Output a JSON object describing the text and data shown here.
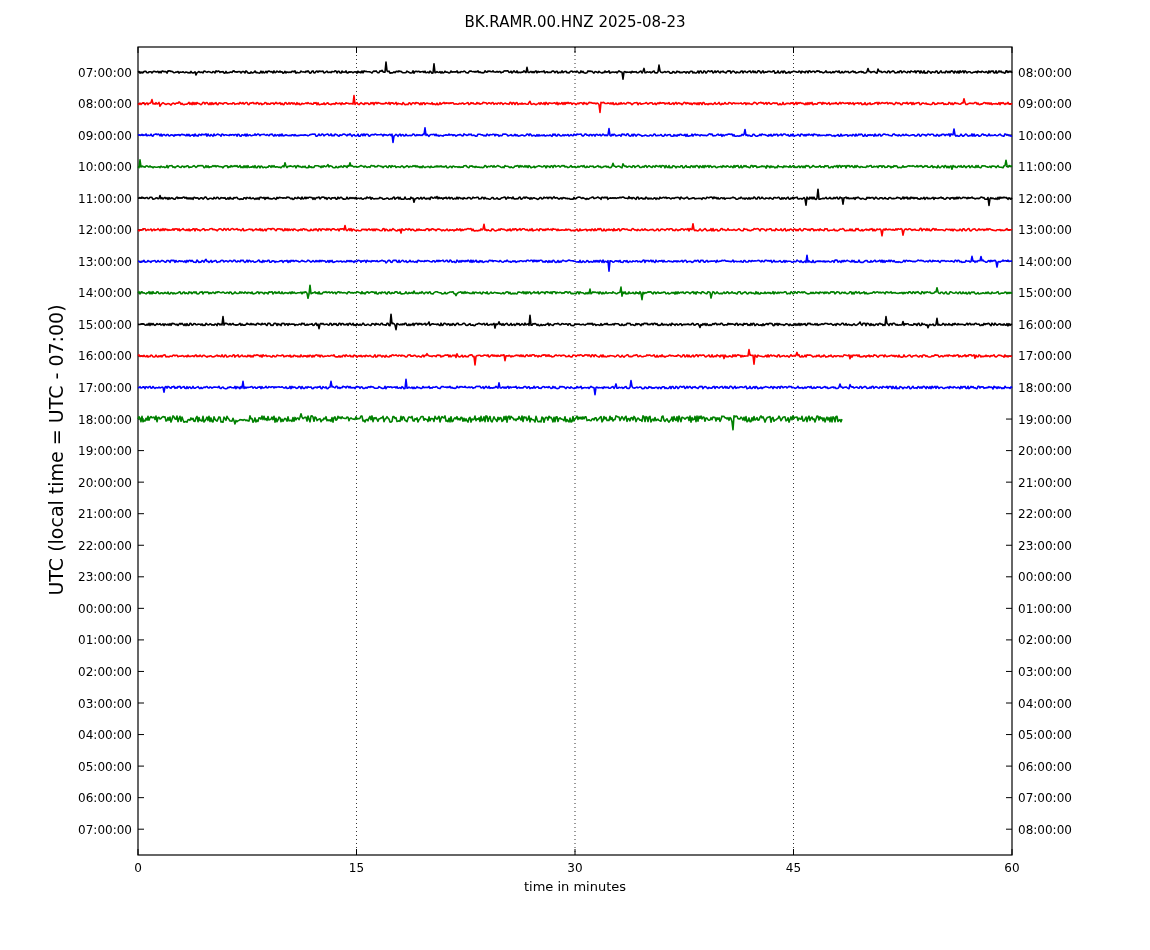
{
  "title": "BK.RAMR.00.HNZ 2025-08-23",
  "ylabel": "UTC (local time = UTC - 07:00)",
  "xlabel": "time in minutes",
  "xticks": [
    "0",
    "15",
    "30",
    "45",
    "60"
  ],
  "left_labels": [
    "07:00:00",
    "08:00:00",
    "09:00:00",
    "10:00:00",
    "11:00:00",
    "12:00:00",
    "13:00:00",
    "14:00:00",
    "15:00:00",
    "16:00:00",
    "17:00:00",
    "18:00:00",
    "19:00:00",
    "20:00:00",
    "21:00:00",
    "22:00:00",
    "23:00:00",
    "00:00:00",
    "01:00:00",
    "02:00:00",
    "03:00:00",
    "04:00:00",
    "05:00:00",
    "06:00:00",
    "07:00:00"
  ],
  "right_labels": [
    "08:00:00",
    "09:00:00",
    "10:00:00",
    "11:00:00",
    "12:00:00",
    "13:00:00",
    "14:00:00",
    "15:00:00",
    "16:00:00",
    "17:00:00",
    "18:00:00",
    "19:00:00",
    "20:00:00",
    "21:00:00",
    "22:00:00",
    "23:00:00",
    "00:00:00",
    "01:00:00",
    "02:00:00",
    "03:00:00",
    "04:00:00",
    "05:00:00",
    "06:00:00",
    "07:00:00",
    "08:00:00"
  ],
  "traces": [
    {
      "color": "#000000",
      "level": 1
    },
    {
      "color": "#ff0000",
      "level": 1
    },
    {
      "color": "#0000ff",
      "level": 1
    },
    {
      "color": "#008000",
      "level": 1
    },
    {
      "color": "#000000",
      "level": 1
    },
    {
      "color": "#ff0000",
      "level": 1
    },
    {
      "color": "#0000ff",
      "level": 1
    },
    {
      "color": "#008000",
      "level": 1
    },
    {
      "color": "#000000",
      "level": 1
    },
    {
      "color": "#ff0000",
      "level": 1
    },
    {
      "color": "#0000ff",
      "level": 1
    },
    {
      "color": "#008000",
      "level": 0.805
    }
  ]
}
